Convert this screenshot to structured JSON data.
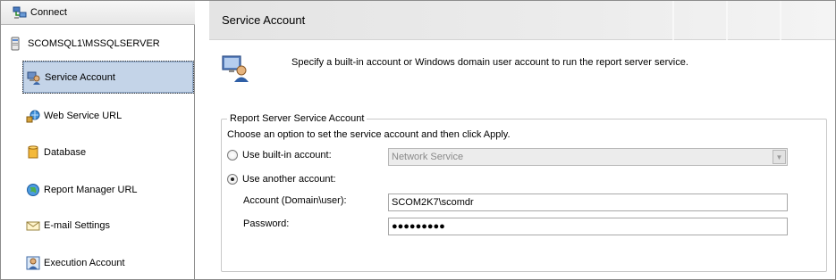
{
  "sidebar": {
    "connect_label": "Connect",
    "server_name": "SCOMSQL1\\MSSQLSERVER",
    "items": [
      {
        "label": "Service Account",
        "icon": "service-account-icon",
        "selected": true
      },
      {
        "label": "Web Service URL",
        "icon": "web-service-icon",
        "selected": false
      },
      {
        "label": "Database",
        "icon": "database-icon",
        "selected": false
      },
      {
        "label": "Report Manager URL",
        "icon": "globe-icon",
        "selected": false
      },
      {
        "label": "E-mail Settings",
        "icon": "email-icon",
        "selected": false
      },
      {
        "label": "Execution Account",
        "icon": "execution-account-icon",
        "selected": false
      }
    ]
  },
  "main": {
    "title": "Service Account",
    "intro_text": "Specify a built-in account or Windows domain user account to run the report server service.",
    "group_title": "Report Server Service Account",
    "choose_text": "Choose an option to set the service account and then click Apply.",
    "builtin_label": "Use built-in account:",
    "builtin_value": "Network Service",
    "another_label": "Use another account:",
    "account_label": "Account (Domain\\user):",
    "account_value": "SCOM2K7\\scomdr",
    "password_label": "Password:",
    "password_value": "●●●●●●●●●",
    "selected_option": "another"
  }
}
